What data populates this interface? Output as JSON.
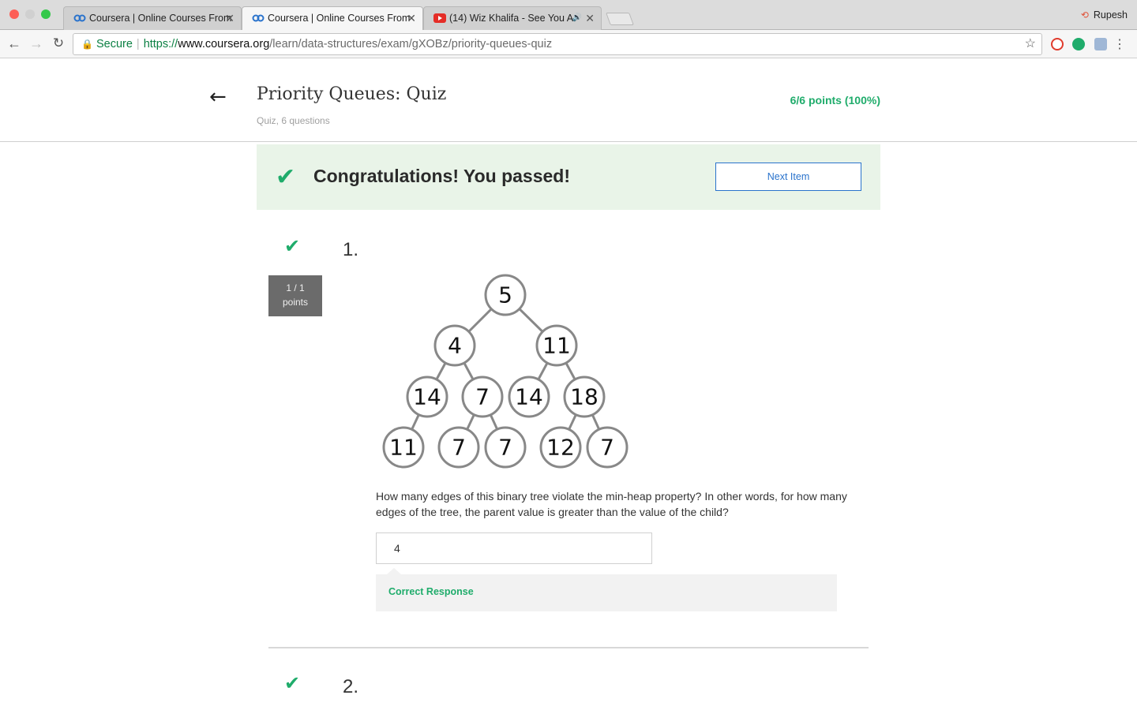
{
  "browser": {
    "tabs": [
      {
        "title": "Coursera | Online Courses From",
        "favicon": "coursera-icon",
        "active": false
      },
      {
        "title": "Coursera | Online Courses From",
        "favicon": "coursera-icon",
        "active": true
      },
      {
        "title": "(14) Wiz Khalifa - See You A",
        "favicon": "youtube-icon",
        "active": false,
        "audio": true
      }
    ],
    "profile_name": "Rupesh",
    "url": {
      "secure_label": "Secure",
      "scheme": "https://",
      "host": "www.coursera.org",
      "path": "/learn/data-structures/exam/gXOBz/priority-queues-quiz"
    }
  },
  "header": {
    "title": "Priority Queues: Quiz",
    "subtitle": "Quiz, 6 questions",
    "score": "6/6 points (100%)"
  },
  "banner": {
    "message": "Congratulations! You passed!",
    "next_button": "Next Item"
  },
  "questions": [
    {
      "number": "1.",
      "points_score": "1 / 1",
      "points_label": "points",
      "tree_values": [
        "5",
        "4",
        "11",
        "14",
        "7",
        "14",
        "18",
        "11",
        "7",
        "7",
        "12",
        "7"
      ],
      "text": "How many edges of this binary tree violate the min-heap property? In other words, for how many edges of the tree, the parent value is greater than the value of the child?",
      "answer": "4",
      "feedback": "Correct Response"
    },
    {
      "number": "2."
    }
  ],
  "colors": {
    "success": "#1fac6b",
    "banner_bg": "#e9f4e8",
    "link": "#2a73cc"
  }
}
